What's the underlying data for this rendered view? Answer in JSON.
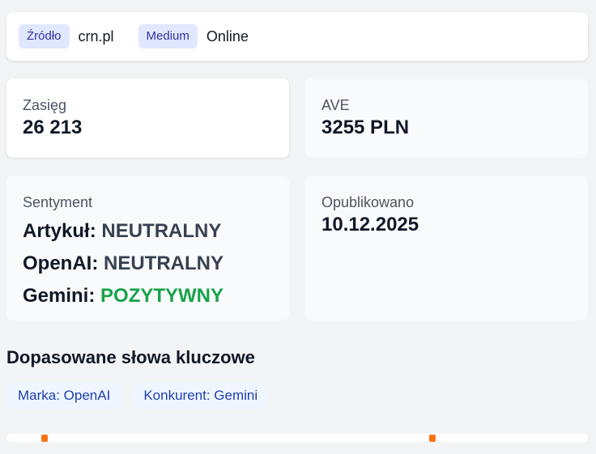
{
  "source": {
    "source_label": "Źródło",
    "source_value": "crn.pl",
    "medium_label": "Medium",
    "medium_value": "Online"
  },
  "reach": {
    "label": "Zasięg",
    "value": "26 213"
  },
  "ave": {
    "label": "AVE",
    "value": "3255 PLN"
  },
  "sentiment": {
    "label": "Sentyment",
    "rows": [
      {
        "name": "Artykuł:",
        "value": "NEUTRALNY",
        "tone": "neutral"
      },
      {
        "name": "OpenAI:",
        "value": "NEUTRALNY",
        "tone": "neutral"
      },
      {
        "name": "Gemini:",
        "value": "POZYTYWNY",
        "tone": "positive"
      }
    ]
  },
  "published": {
    "label": "Opublikowano",
    "value": "10.12.2025"
  },
  "keywords": {
    "title": "Dopasowane słowa kluczowe",
    "chips": [
      "Marka: OpenAI",
      "Konkurent: Gemini"
    ]
  },
  "colors": {
    "accent_pill": "#e0e7ff",
    "positive": "#16a34a",
    "neutral": "#374151",
    "marker": "#f97316"
  }
}
